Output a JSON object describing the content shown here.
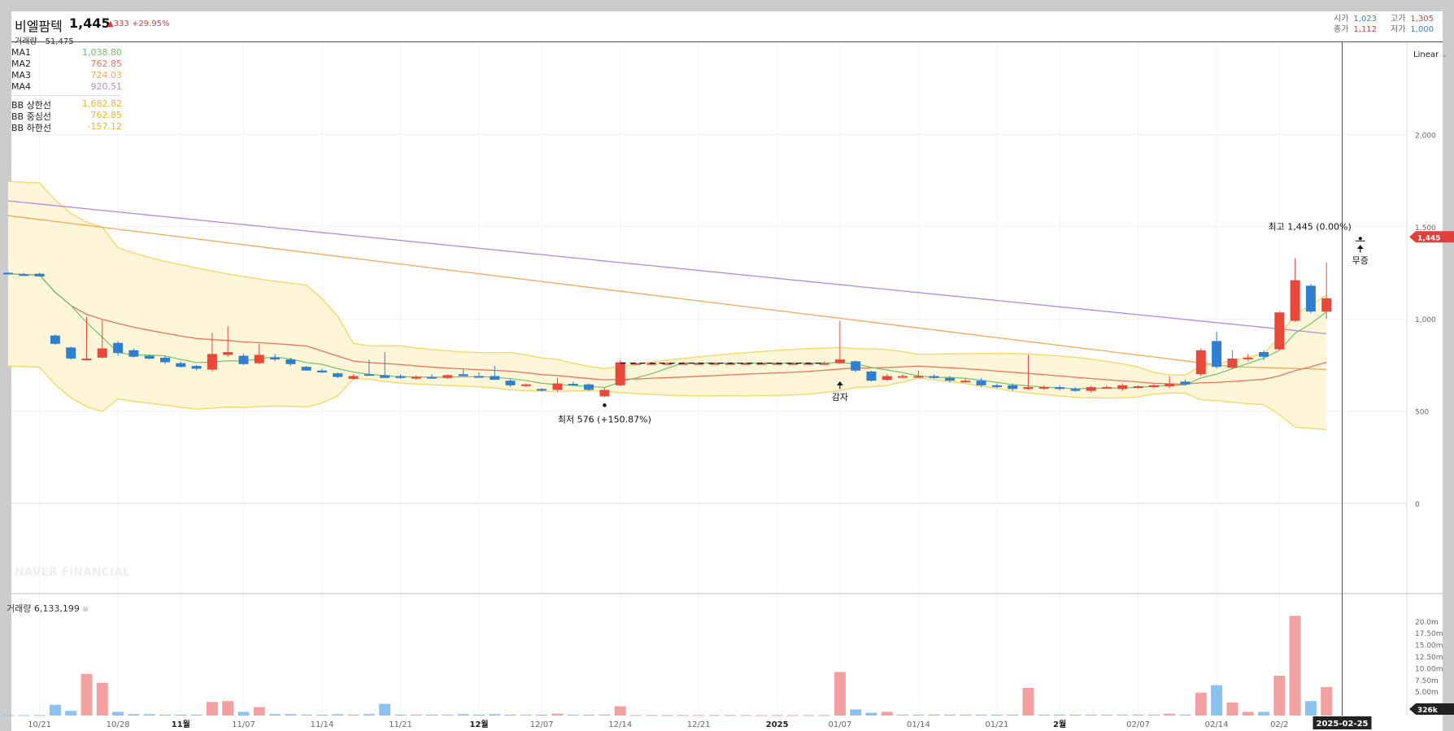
{
  "header": {
    "stock_name": "비엘팜텍",
    "price": "1,445",
    "change": "▲333 +29.95%",
    "volume_label": "거래량",
    "volume_value": "51,475",
    "open_label": "시가",
    "open_value": "1,023",
    "high_label": "고가",
    "high_value": "1,305",
    "close_label": "종가",
    "close_value": "1,112",
    "low_label": "저가",
    "low_value": "1,000"
  },
  "legend": {
    "ma1_label": "MA1",
    "ma1_value": "1,038.80",
    "ma2_label": "MA2",
    "ma2_value": "762.85",
    "ma3_label": "MA3",
    "ma3_value": "724.03",
    "ma4_label": "MA4",
    "ma4_value": "920.51",
    "bb_upper_label": "BB 상한선",
    "bb_upper_value": "1,682.82",
    "bb_mid_label": "BB 중심선",
    "bb_mid_value": "762.85",
    "bb_lower_label": "BB 하한선",
    "bb_lower_value": "-157.12"
  },
  "colors": {
    "up": "#e8483a",
    "down": "#2f7fd1",
    "ma1": "#6cc36c",
    "ma2": "#e8745a",
    "ma3": "#f0a85a",
    "ma4": "#b48ad8",
    "bb": "#f5d867",
    "bbfill": "#fff6d9",
    "vol_up": "#f2a0a0",
    "vol_down": "#8cc2f2"
  },
  "scale_label": "Linear",
  "watermark": "NAVER FINANCIAL",
  "volume_panel": {
    "label": "거래량 6,133,199"
  },
  "chart_data": {
    "type": "candlestick",
    "y_ticks": [
      0,
      500,
      1000,
      1500,
      2000
    ],
    "y_tick_labels": [
      "0",
      "500",
      "1,000",
      "1,500",
      "2,000"
    ],
    "ylim": [
      -380,
      2400
    ],
    "x_tick_labels": [
      "10/21",
      "10/28",
      "11월",
      "11/07",
      "11/14",
      "11/21",
      "12월",
      "12/07",
      "12/14",
      "12/21",
      "2025",
      "01/07",
      "01/14",
      "01/21",
      "2월",
      "02/07",
      "02/14",
      "02/2",
      "2025-02-25"
    ],
    "x_tick_index": [
      2,
      7,
      11,
      15,
      20,
      25,
      30,
      34,
      39,
      44,
      49,
      53,
      58,
      63,
      67,
      72,
      77,
      81,
      85
    ],
    "candles": [
      {
        "o": 1250,
        "h": 1255,
        "l": 1240,
        "c": 1245
      },
      {
        "o": 1242,
        "h": 1250,
        "l": 1235,
        "c": 1238
      },
      {
        "o": 1245,
        "h": 1250,
        "l": 1230,
        "c": 1230
      },
      {
        "o": 910,
        "h": 915,
        "l": 860,
        "c": 865
      },
      {
        "o": 845,
        "h": 850,
        "l": 780,
        "c": 785
      },
      {
        "o": 780,
        "h": 1010,
        "l": 775,
        "c": 785
      },
      {
        "o": 790,
        "h": 995,
        "l": 785,
        "c": 840
      },
      {
        "o": 870,
        "h": 880,
        "l": 800,
        "c": 815
      },
      {
        "o": 830,
        "h": 840,
        "l": 790,
        "c": 795
      },
      {
        "o": 800,
        "h": 805,
        "l": 780,
        "c": 785
      },
      {
        "o": 790,
        "h": 800,
        "l": 755,
        "c": 765
      },
      {
        "o": 760,
        "h": 770,
        "l": 735,
        "c": 740
      },
      {
        "o": 745,
        "h": 750,
        "l": 720,
        "c": 730
      },
      {
        "o": 725,
        "h": 925,
        "l": 715,
        "c": 810
      },
      {
        "o": 805,
        "h": 960,
        "l": 795,
        "c": 820
      },
      {
        "o": 800,
        "h": 810,
        "l": 750,
        "c": 755
      },
      {
        "o": 760,
        "h": 865,
        "l": 755,
        "c": 805
      },
      {
        "o": 790,
        "h": 810,
        "l": 770,
        "c": 780
      },
      {
        "o": 780,
        "h": 790,
        "l": 745,
        "c": 755
      },
      {
        "o": 740,
        "h": 745,
        "l": 720,
        "c": 720
      },
      {
        "o": 720,
        "h": 730,
        "l": 705,
        "c": 710
      },
      {
        "o": 705,
        "h": 710,
        "l": 680,
        "c": 685
      },
      {
        "o": 675,
        "h": 700,
        "l": 670,
        "c": 690
      },
      {
        "o": 700,
        "h": 780,
        "l": 695,
        "c": 695
      },
      {
        "o": 695,
        "h": 820,
        "l": 680,
        "c": 680
      },
      {
        "o": 690,
        "h": 700,
        "l": 675,
        "c": 680
      },
      {
        "o": 685,
        "h": 695,
        "l": 670,
        "c": 685
      },
      {
        "o": 685,
        "h": 700,
        "l": 675,
        "c": 680
      },
      {
        "o": 680,
        "h": 700,
        "l": 675,
        "c": 695
      },
      {
        "o": 700,
        "h": 725,
        "l": 690,
        "c": 690
      },
      {
        "o": 690,
        "h": 710,
        "l": 680,
        "c": 685
      },
      {
        "o": 690,
        "h": 745,
        "l": 670,
        "c": 670
      },
      {
        "o": 665,
        "h": 675,
        "l": 630,
        "c": 640
      },
      {
        "o": 640,
        "h": 650,
        "l": 630,
        "c": 645
      },
      {
        "o": 620,
        "h": 625,
        "l": 608,
        "c": 615
      },
      {
        "o": 615,
        "h": 680,
        "l": 605,
        "c": 650
      },
      {
        "o": 648,
        "h": 660,
        "l": 640,
        "c": 645
      },
      {
        "o": 645,
        "h": 650,
        "l": 610,
        "c": 615
      },
      {
        "o": 580,
        "h": 625,
        "l": 576,
        "c": 615
      },
      {
        "o": 640,
        "h": 775,
        "l": 635,
        "c": 765
      },
      {
        "o": 760,
        "h": 765,
        "l": 760,
        "c": 760
      },
      {
        "o": 760,
        "h": 765,
        "l": 760,
        "c": 760
      },
      {
        "o": 760,
        "h": 765,
        "l": 760,
        "c": 760
      },
      {
        "o": 760,
        "h": 765,
        "l": 760,
        "c": 760
      },
      {
        "o": 760,
        "h": 765,
        "l": 760,
        "c": 760
      },
      {
        "o": 760,
        "h": 765,
        "l": 760,
        "c": 760
      },
      {
        "o": 760,
        "h": 765,
        "l": 760,
        "c": 760
      },
      {
        "o": 760,
        "h": 765,
        "l": 760,
        "c": 760
      },
      {
        "o": 760,
        "h": 765,
        "l": 760,
        "c": 760
      },
      {
        "o": 760,
        "h": 765,
        "l": 760,
        "c": 760
      },
      {
        "o": 760,
        "h": 765,
        "l": 760,
        "c": 760
      },
      {
        "o": 760,
        "h": 765,
        "l": 760,
        "c": 760
      },
      {
        "o": 760,
        "h": 770,
        "l": 760,
        "c": 760
      },
      {
        "o": 760,
        "h": 990,
        "l": 755,
        "c": 780
      },
      {
        "o": 770,
        "h": 775,
        "l": 710,
        "c": 720
      },
      {
        "o": 715,
        "h": 720,
        "l": 660,
        "c": 665
      },
      {
        "o": 670,
        "h": 700,
        "l": 665,
        "c": 690
      },
      {
        "o": 690,
        "h": 700,
        "l": 680,
        "c": 690
      },
      {
        "o": 690,
        "h": 720,
        "l": 685,
        "c": 690
      },
      {
        "o": 690,
        "h": 700,
        "l": 675,
        "c": 680
      },
      {
        "o": 680,
        "h": 690,
        "l": 655,
        "c": 665
      },
      {
        "o": 665,
        "h": 675,
        "l": 655,
        "c": 665
      },
      {
        "o": 665,
        "h": 680,
        "l": 630,
        "c": 640
      },
      {
        "o": 640,
        "h": 650,
        "l": 625,
        "c": 630
      },
      {
        "o": 640,
        "h": 650,
        "l": 610,
        "c": 620
      },
      {
        "o": 620,
        "h": 805,
        "l": 615,
        "c": 630
      },
      {
        "o": 625,
        "h": 640,
        "l": 615,
        "c": 630
      },
      {
        "o": 630,
        "h": 640,
        "l": 612,
        "c": 620
      },
      {
        "o": 620,
        "h": 630,
        "l": 605,
        "c": 610
      },
      {
        "o": 610,
        "h": 640,
        "l": 600,
        "c": 630
      },
      {
        "o": 630,
        "h": 640,
        "l": 625,
        "c": 630
      },
      {
        "o": 620,
        "h": 650,
        "l": 610,
        "c": 640
      },
      {
        "o": 630,
        "h": 640,
        "l": 620,
        "c": 635
      },
      {
        "o": 630,
        "h": 650,
        "l": 625,
        "c": 640
      },
      {
        "o": 635,
        "h": 690,
        "l": 625,
        "c": 650
      },
      {
        "o": 660,
        "h": 670,
        "l": 640,
        "c": 645
      },
      {
        "o": 700,
        "h": 840,
        "l": 690,
        "c": 830
      },
      {
        "o": 880,
        "h": 930,
        "l": 730,
        "c": 740
      },
      {
        "o": 735,
        "h": 830,
        "l": 730,
        "c": 785
      },
      {
        "o": 790,
        "h": 810,
        "l": 770,
        "c": 790
      },
      {
        "o": 820,
        "h": 830,
        "l": 775,
        "c": 795
      },
      {
        "o": 835,
        "h": 1040,
        "l": 830,
        "c": 1035
      },
      {
        "o": 990,
        "h": 1330,
        "l": 985,
        "c": 1210
      },
      {
        "o": 1180,
        "h": 1190,
        "l": 1030,
        "c": 1040
      },
      {
        "o": 1040,
        "h": 1305,
        "l": 1000,
        "c": 1112
      }
    ],
    "volumes": [
      0.1,
      0.1,
      0.1,
      2.3,
      1.0,
      8.9,
      7.0,
      0.8,
      0.3,
      0.3,
      0.2,
      0.2,
      0.2,
      2.9,
      3.1,
      0.8,
      1.8,
      0.3,
      0.3,
      0.2,
      0.2,
      0.3,
      0.2,
      0.3,
      2.5,
      0.2,
      0.2,
      0.2,
      0.2,
      0.3,
      0.2,
      0.3,
      0.2,
      0.2,
      0.2,
      0.4,
      0.2,
      0.2,
      0.2,
      2.0,
      0.1,
      0.1,
      0.1,
      0.1,
      0.1,
      0.1,
      0.1,
      0.1,
      0.1,
      0.1,
      0.1,
      0.1,
      0.1,
      9.3,
      1.3,
      0.6,
      0.8,
      0.2,
      0.2,
      0.2,
      0.2,
      0.2,
      0.2,
      0.2,
      0.2,
      5.9,
      0.2,
      0.2,
      0.2,
      0.2,
      0.2,
      0.2,
      0.2,
      0.2,
      0.4,
      0.2,
      4.9,
      6.5,
      2.8,
      0.8,
      0.8,
      8.5,
      21.3,
      3.1,
      6.1
    ],
    "vol_ticks": [
      "5.00m",
      "7.50m",
      "10.00m",
      "12.50m",
      "15.00m",
      "17.50m",
      "20.0m"
    ],
    "vol_tick_values": [
      5,
      7.5,
      10,
      12.5,
      15,
      17.5,
      20
    ],
    "current_price_tag": "1,445",
    "volume_tag": "326k",
    "annotations": {
      "low": "최저 576 (+150.87%)",
      "high": "최고 1,445 (0.00%)",
      "gamja": "감자",
      "mujeung": "무증"
    }
  }
}
